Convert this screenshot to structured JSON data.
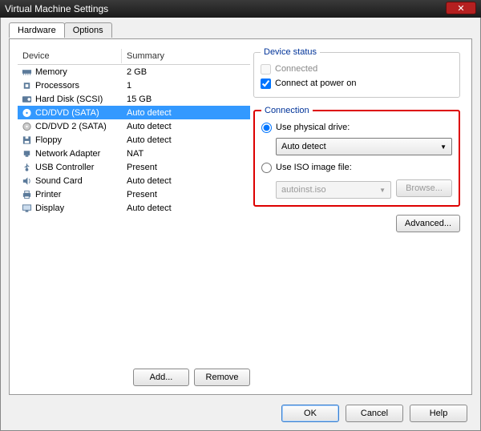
{
  "titlebar": {
    "title": "Virtual Machine Settings"
  },
  "tabs": [
    {
      "label": "Hardware",
      "active": true
    },
    {
      "label": "Options",
      "active": false
    }
  ],
  "columns": {
    "device": "Device",
    "summary": "Summary"
  },
  "devices": [
    {
      "name": "Memory",
      "summary": "2 GB",
      "icon": "memory"
    },
    {
      "name": "Processors",
      "summary": "1",
      "icon": "cpu"
    },
    {
      "name": "Hard Disk (SCSI)",
      "summary": "15 GB",
      "icon": "hdd"
    },
    {
      "name": "CD/DVD (SATA)",
      "summary": "Auto detect",
      "icon": "cd",
      "selected": true
    },
    {
      "name": "CD/DVD 2 (SATA)",
      "summary": "Auto detect",
      "icon": "cd"
    },
    {
      "name": "Floppy",
      "summary": "Auto detect",
      "icon": "floppy"
    },
    {
      "name": "Network Adapter",
      "summary": "NAT",
      "icon": "net"
    },
    {
      "name": "USB Controller",
      "summary": "Present",
      "icon": "usb"
    },
    {
      "name": "Sound Card",
      "summary": "Auto detect",
      "icon": "sound"
    },
    {
      "name": "Printer",
      "summary": "Present",
      "icon": "printer"
    },
    {
      "name": "Display",
      "summary": "Auto detect",
      "icon": "display"
    }
  ],
  "left_buttons": {
    "add": "Add...",
    "remove": "Remove"
  },
  "device_status": {
    "legend": "Device status",
    "connected_label": "Connected",
    "connected_checked": false,
    "power_on_label": "Connect at power on",
    "power_on_checked": true
  },
  "connection": {
    "legend": "Connection",
    "physical_label": "Use physical drive:",
    "physical_selected": true,
    "drive_value": "Auto detect",
    "iso_label": "Use ISO image file:",
    "iso_selected": false,
    "iso_value": "autoinst.iso",
    "browse_label": "Browse..."
  },
  "advanced_label": "Advanced...",
  "dialog_buttons": {
    "ok": "OK",
    "cancel": "Cancel",
    "help": "Help"
  }
}
